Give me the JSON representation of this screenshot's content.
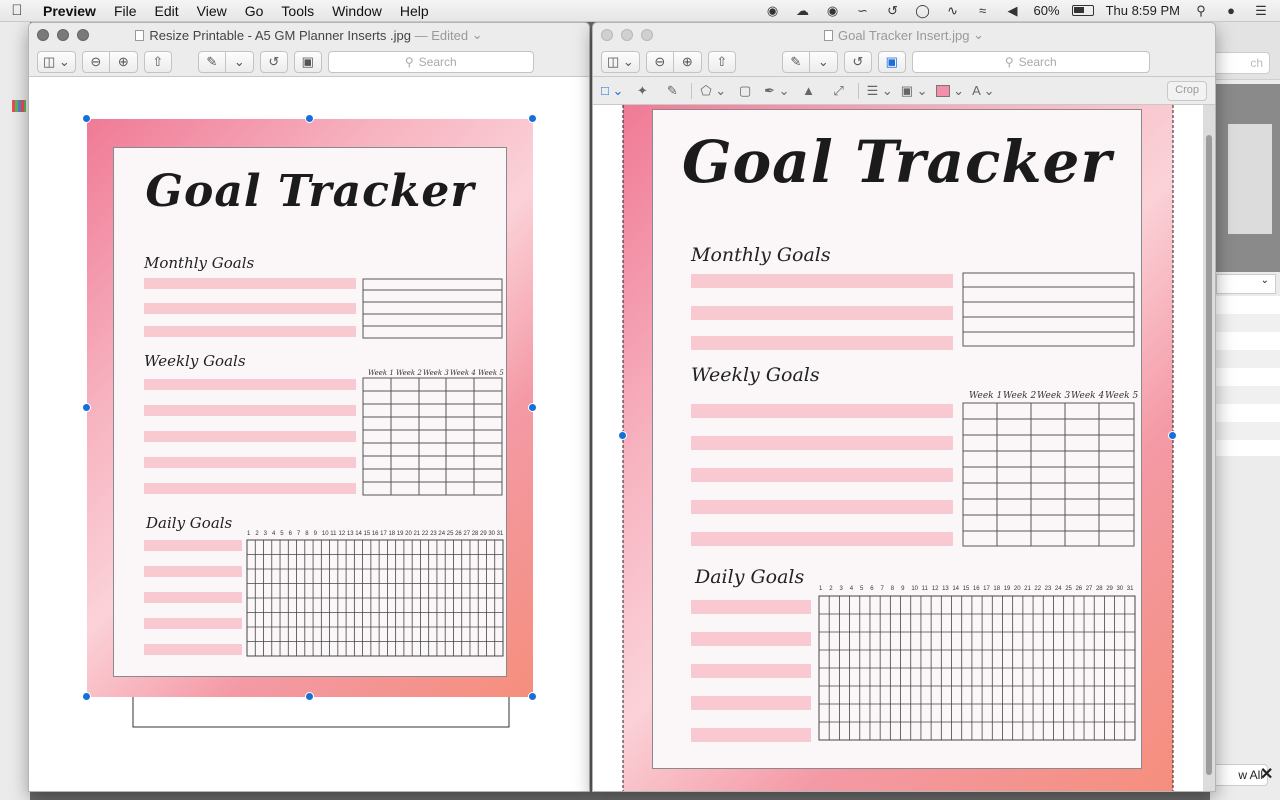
{
  "menubar": {
    "app": "Preview",
    "items": [
      "File",
      "Edit",
      "View",
      "Go",
      "Tools",
      "Window",
      "Help"
    ],
    "battery": "60%",
    "clock": "Thu 8:59 PM"
  },
  "left_window": {
    "title": "Resize Printable - A5 GM Planner Inserts .jpg",
    "edited": "— Edited",
    "search_placeholder": "Search"
  },
  "right_window": {
    "title": "Goal Tracker Insert.jpg",
    "search_placeholder": "Search",
    "crop_label": "Crop"
  },
  "background_app": {
    "search_fragment": "ch",
    "show_all_fragment": "w All"
  },
  "planner": {
    "title": "Goal Tracker",
    "monthly": "Monthly Goals",
    "weekly": "Weekly Goals",
    "daily": "Daily Goals",
    "weeks": [
      "Week 1",
      "Week 2",
      "Week 3",
      "Week 4",
      "Week 5"
    ],
    "days": [
      "1",
      "2",
      "3",
      "4",
      "5",
      "6",
      "7",
      "8",
      "9",
      "10",
      "11",
      "12",
      "13",
      "14",
      "15",
      "16",
      "17",
      "18",
      "19",
      "20",
      "21",
      "22",
      "23",
      "24",
      "25",
      "26",
      "27",
      "28",
      "29",
      "30",
      "31"
    ]
  },
  "colors": {
    "accent_blue": "#1670d8",
    "pink_line": "#f9c9d2",
    "page_pink": "#f07a96",
    "page_coral": "#f58e7c"
  }
}
